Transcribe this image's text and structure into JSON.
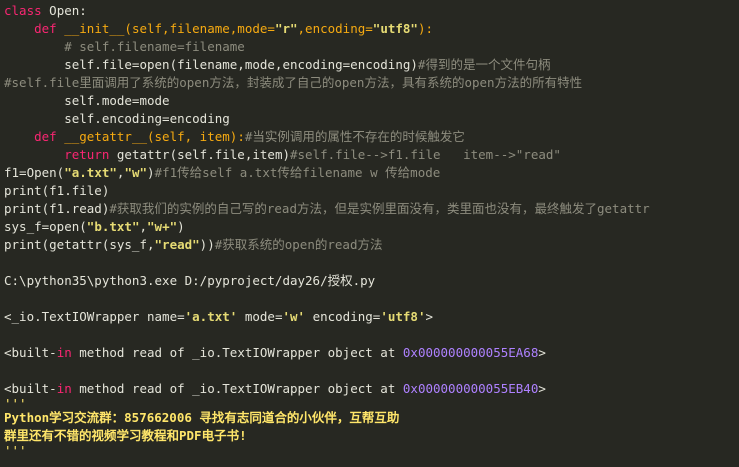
{
  "colors": {
    "background": "#272822",
    "keyword": "#f92672",
    "function": "#f6aa11",
    "string": "#e6db74",
    "comment": "#8d8c7e",
    "text": "#e4e4d9",
    "address": "#ae81ff",
    "banner": "#ffe66a"
  },
  "code": {
    "l1_kw": "class",
    "l1_name": " Open:",
    "l2_indent": "    ",
    "l2_kw": "def",
    "l2_fn": " __init__(",
    "l2_params_a": "self,filename,mode=",
    "l2_str1": "\"r\"",
    "l2_params_b": ",encoding=",
    "l2_str2": "\"utf8\"",
    "l2_end": "):",
    "l3": "        # self.filename=filename",
    "l4_code": "        self.file=open(filename,mode,encoding=encoding)",
    "l4_comment": "#得到的是一个文件句柄",
    "l5": "#self.file里面调用了系统的open方法，封装成了自己的open方法，具有系统的open方法的所有特性",
    "l6": "        self.mode=mode",
    "l7": "        self.encoding=encoding",
    "l8_indent": "    ",
    "l8_kw": "def",
    "l8_fn": " __getattr__(",
    "l8_params": "self, item",
    "l8_end": "):",
    "l8_comment": "#当实例调用的属性不存在的时候触发它",
    "l9_indent": "        ",
    "l9_kw": "return",
    "l9_code": " getattr(self.file,item)",
    "l9_comment": "#self.file-->f1.file   item-->\"read\"",
    "l10_code_a": "f1=Open(",
    "l10_str1": "\"a.txt\"",
    "l10_code_b": ",",
    "l10_str2": "\"w\"",
    "l10_code_c": ")",
    "l10_comment": "#f1传给self a.txt传给filename w 传给mode",
    "l11": "print(f1.file)",
    "l12_code": "print(f1.read)",
    "l12_comment": "#获取我们的实例的自己写的read方法，但是实例里面没有，类里面也没有，最终触发了getattr",
    "l13_code_a": "sys_f=open(",
    "l13_str1": "\"b.txt\"",
    "l13_code_b": ",",
    "l13_str2": "\"w+\"",
    "l13_code_c": ")",
    "l14_code_a": "print(getattr(sys_f,",
    "l14_str": "\"read\"",
    "l14_code_b": "))",
    "l14_comment": "#获取系统的open的read方法"
  },
  "output": {
    "cmd": "C:\\python35\\python3.exe D:/pyproject/day26/授权.py",
    "o1_a": "<_io.TextIOWrapper name=",
    "o1_s1": "'a.txt'",
    "o1_b": " mode=",
    "o1_s2": "'w'",
    "o1_c": " encoding=",
    "o1_s3": "'utf8'",
    "o1_d": ">",
    "o2_a": "<built-",
    "o2_in": "in",
    "o2_b": " method read of _io.TextIOWrapper object at ",
    "o2_addr": "0x000000000055EA68",
    "o2_c": ">",
    "o3_a": "<built-",
    "o3_in": "in",
    "o3_b": " method read of _io.TextIOWrapper object at ",
    "o3_addr": "0x000000000055EB40",
    "o3_c": ">",
    "q1": "'''",
    "banner1": "Python学习交流群：857662006 寻找有志同道合的小伙伴，互帮互助",
    "banner2": "群里还有不错的视频学习教程和PDF电子书!",
    "q2": "'''"
  }
}
